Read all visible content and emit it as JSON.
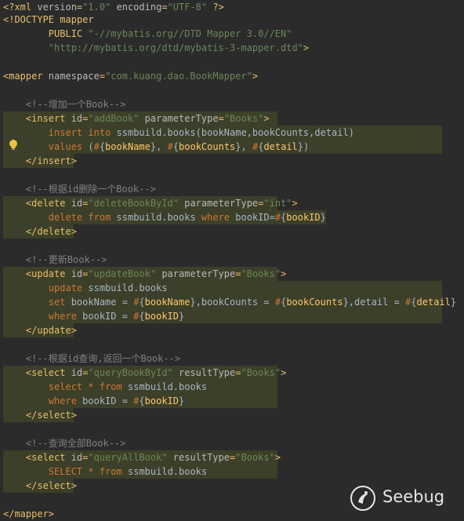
{
  "lines": [
    "<?xml version=\"1.0\" encoding=\"UTF-8\" ?>",
    "<!DOCTYPE mapper",
    "        PUBLIC \"-//mybatis.org//DTD Mapper 3.0//EN\"",
    "        \"http://mybatis.org/dtd/mybatis-3-mapper.dtd\">",
    "<mapper namespace=\"com.kuang.dao.BookMapper\">",
    "    <!--增加一个Book-->",
    "    <insert id=\"addBook\" parameterType=\"Books\">",
    "        insert into ssmbuild.books(bookName,bookCounts,detail)",
    "        values (#{bookName}, #{bookCounts}, #{detail})",
    "    </insert>",
    "    <!--根据id删除一个Book-->",
    "    <delete id=\"deleteBookById\" parameterType=\"int\">",
    "        delete from ssmbuild.books where bookID=#{bookID}",
    "    </delete>",
    "    <!--更新Book-->",
    "    <update id=\"updateBook\" parameterType=\"Books\">",
    "        update ssmbuild.books",
    "        set bookName = #{bookName},bookCounts = #{bookCounts},detail = #{detail}",
    "        where bookID = #{bookID}",
    "    </update>",
    "    <!--根据id查询,返回一个Book-->",
    "    <select id=\"queryBookById\" resultType=\"Books\">",
    "        select * from ssmbuild.books",
    "        where bookID = #{bookID}",
    "    </select>",
    "    <!--查询全部Book-->",
    "    <select id=\"queryAllBook\" resultType=\"Books\">",
    "        SELECT * from ssmbuild.books",
    "    </select>",
    "</mapper>"
  ],
  "watermark": {
    "brand": "Seebug",
    "icon": "seebug-logo-icon"
  },
  "icons": {
    "hint": "lightbulb-icon"
  },
  "colors": {
    "background": "#2b2b2b",
    "tag": "#e8bf6a",
    "attribute": "#bababa",
    "string": "#6a8759",
    "comment": "#808080",
    "keyword": "#cc7832",
    "placeholder": "#ffc66d",
    "highlight": "#3c3f29"
  }
}
